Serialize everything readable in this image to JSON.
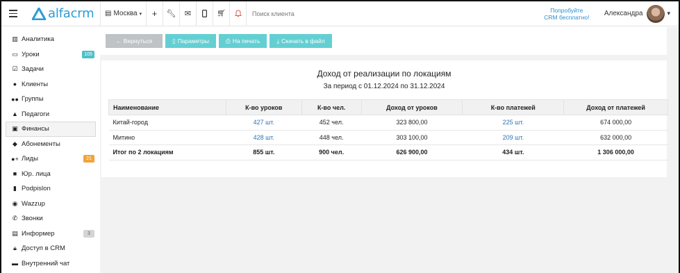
{
  "header": {
    "logo_text": "alfacrm",
    "branch": "Москва",
    "search_placeholder": "Поиск клиента",
    "promo_line1": "Попробуйте",
    "promo_line2": "CRM бесплатно!",
    "user_name": "Александра"
  },
  "sidebar": {
    "items": [
      {
        "label": "Аналитика",
        "icon": "chart-icon"
      },
      {
        "label": "Уроки",
        "icon": "calendar-icon",
        "badge": "105"
      },
      {
        "label": "Задачи",
        "icon": "tasks-icon"
      },
      {
        "label": "Клиенты",
        "icon": "user-icon"
      },
      {
        "label": "Группы",
        "icon": "users-icon"
      },
      {
        "label": "Педагоги",
        "icon": "graduation-cap-icon"
      },
      {
        "label": "Финансы",
        "icon": "finance-icon"
      },
      {
        "label": "Абонементы",
        "icon": "tag-icon"
      },
      {
        "label": "Лиды",
        "icon": "user-plus-icon",
        "badge": "21"
      },
      {
        "label": "Юр. лица",
        "icon": "briefcase-icon"
      },
      {
        "label": "Podpislon",
        "icon": "file-icon"
      },
      {
        "label": "Wazzup",
        "icon": "whatsapp-icon"
      },
      {
        "label": "Звонки",
        "icon": "phone-icon"
      },
      {
        "label": "Информер",
        "icon": "book-icon",
        "badge": "3"
      },
      {
        "label": "Доступ в CRM",
        "icon": "lock-icon"
      },
      {
        "label": "Внутренний чат",
        "icon": "chat-icon"
      }
    ]
  },
  "toolbar": {
    "back": "← Вернуться",
    "params": "Параметры",
    "print": "На печать",
    "download": "Скачать в файл"
  },
  "report": {
    "title": "Доход от реализации по локациям",
    "subtitle": "За период с 01.12.2024 по 31.12.2024",
    "columns": [
      "Наименование",
      "К-во уроков",
      "К-во чел.",
      "Доход от уроков",
      "К-во платежей",
      "Доход от платежей"
    ],
    "rows": [
      [
        "Китай-город",
        "427 шт.",
        "452 чел.",
        "323 800,00",
        "225 шт.",
        "674 000,00"
      ],
      [
        "Митино",
        "428 шт.",
        "448 чел.",
        "303 100,00",
        "209 шт.",
        "632 000,00"
      ]
    ],
    "total": [
      "Итог по 2 локациям",
      "855 шт.",
      "900 чел.",
      "626 900,00",
      "434 шт.",
      "1 306 000,00"
    ]
  },
  "colors": {
    "accent": "#2b9bd6",
    "button_teal": "#63cfd3",
    "button_grey": "#bfc3c6",
    "link": "#2b72b8"
  }
}
